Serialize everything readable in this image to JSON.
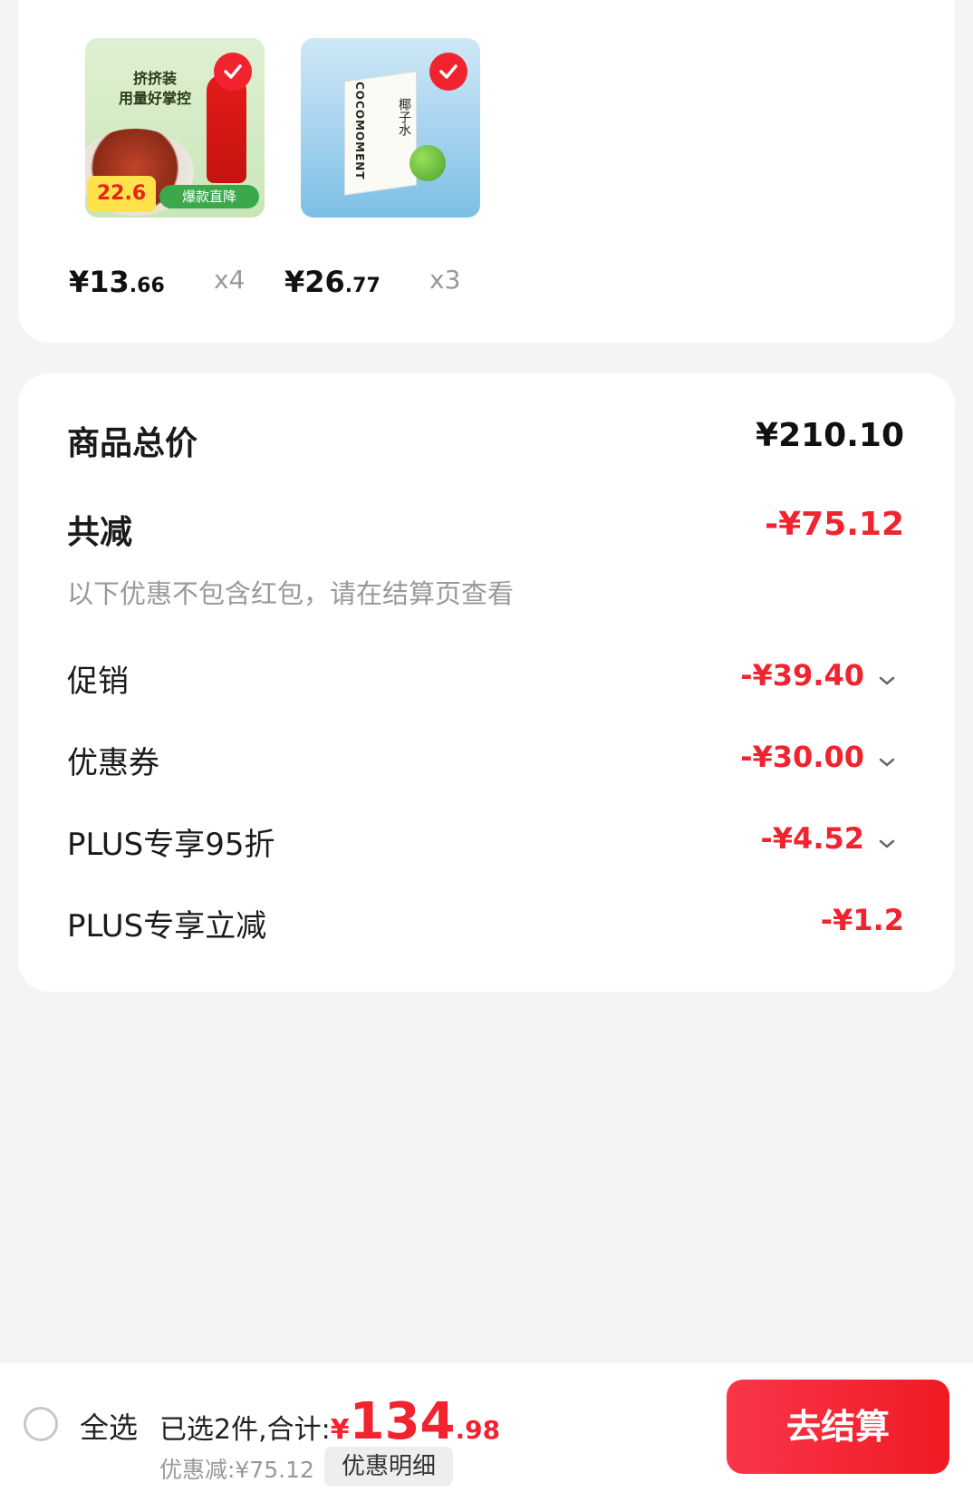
{
  "products": [
    {
      "image_label": "oyster-sauce-product",
      "promo_lines": [
        "挤挤装",
        "用量好掌控"
      ],
      "badge_price": "22.6",
      "badge_text": "爆款直降",
      "price_int": "¥13",
      "price_dec": ".66",
      "qty": "x4"
    },
    {
      "image_label": "coconut-water-product",
      "promo_lines": [
        "COCOMOMENT",
        "椰子水"
      ],
      "price_int": "¥26",
      "price_dec": ".77",
      "qty": "x3"
    }
  ],
  "summary": {
    "total_label": "商品总价",
    "total_value": "¥210.10",
    "discount_label": "共减",
    "discount_value": "-¥75.12",
    "discount_note": "以下优惠不包含红包，请在结算页查看",
    "items": [
      {
        "label": "促销",
        "value": "-¥39.40",
        "expandable": true
      },
      {
        "label": "优惠券",
        "value": "-¥30.00",
        "expandable": true
      },
      {
        "label": "PLUS专享95折",
        "value": "-¥4.52",
        "expandable": true
      },
      {
        "label": "PLUS专享立减",
        "value": "-¥1.2",
        "expandable": false
      }
    ]
  },
  "bottom": {
    "select_all": "全选",
    "selected_text": "已选2件,合计:",
    "currency": "¥",
    "amount_int": "134",
    "amount_dec": ".98",
    "saved_text": "优惠减:¥75.12",
    "detail_button": "优惠明细",
    "checkout_button": "去结算"
  }
}
